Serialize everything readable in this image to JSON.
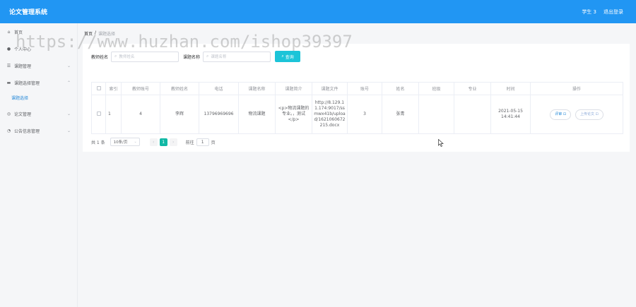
{
  "header": {
    "title": "论文管理系统",
    "user": "学生 3",
    "logout": "退出登录"
  },
  "sidebar": {
    "items": [
      {
        "icon": "home-icon",
        "glyph": "⌂",
        "label": "首页"
      },
      {
        "icon": "user-icon",
        "glyph": "●",
        "label": "个人中心"
      },
      {
        "icon": "list-icon",
        "glyph": "☰",
        "label": "课题管理"
      },
      {
        "icon": "list-icon",
        "glyph": "▬",
        "label": "课题选择管理"
      },
      {
        "label": "课题选择"
      },
      {
        "icon": "doc-icon",
        "glyph": "◎",
        "label": "论文管理"
      },
      {
        "icon": "bell-icon",
        "glyph": "◔",
        "label": "公告信息管理"
      }
    ]
  },
  "breadcrumb": {
    "home": "首页",
    "sep": "/",
    "current": "课题选择"
  },
  "search": {
    "teacher_label": "教师姓名",
    "teacher_placeholder": "教师姓名",
    "topic_label": "课题名称",
    "topic_placeholder": "课题名称",
    "button": "查询"
  },
  "table": {
    "headers": [
      "",
      "索引",
      "教师账号",
      "教师姓名",
      "电话",
      "课题名称",
      "课题简介",
      "课题文件",
      "账号",
      "姓名",
      "班级",
      "专业",
      "时间",
      "操作"
    ],
    "rows": [
      {
        "index": "1",
        "teacher_account": "4",
        "teacher_name": "李辉",
        "phone": "13796969696",
        "topic_name": "物流课题",
        "topic_intro": "<p>物流课题的专业。，测试</p>",
        "topic_file": "http://8.129.11.174:9017/ssmwx41b/upload/1621060672215.docx",
        "account": "3",
        "name": "张青",
        "class": "",
        "major": "",
        "time": "2021-05-15 14:41:44",
        "op_review": "评审 ⊡",
        "op_upload": "上传论文 ⊡"
      }
    ]
  },
  "pagination": {
    "total": "共 1 条",
    "page_size": "10条/页",
    "prev": "‹",
    "current": "1",
    "next": "›",
    "goto": "前往",
    "goto_value": "1",
    "page_unit": "页"
  },
  "watermark": "https://www.huzhan.com/ishop39397",
  "colors": {
    "header": "#2196f3",
    "search_button": "#1cc4d8",
    "active_page": "#11b8a5"
  }
}
